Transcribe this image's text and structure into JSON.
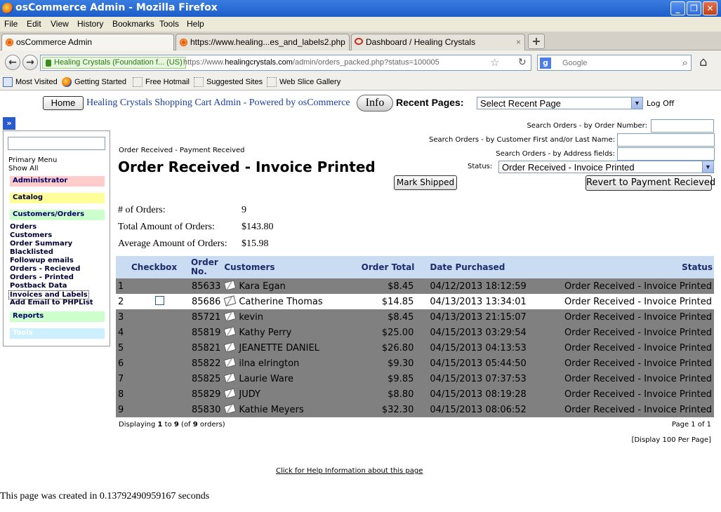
{
  "window": {
    "title": "osCommerce Admin - Mozilla Firefox",
    "min": "_",
    "max": "❐",
    "close": "✕"
  },
  "menu": [
    "File",
    "Edit",
    "View",
    "History",
    "Bookmarks",
    "Tools",
    "Help"
  ],
  "tabs": [
    {
      "label": "osCommerce Admin",
      "close": "×"
    },
    {
      "label": "https://www.healing...es_and_labels2.php",
      "close": "×"
    },
    {
      "label": "Dashboard / Healing Crystals",
      "close": "×"
    }
  ],
  "newtab": "+",
  "nav": {
    "back": "←",
    "forward": "→",
    "identity": "Healing Crystals (Foundation f...  (US)",
    "url_prefix": "https://www.",
    "url_domain": "healingcrystals.com",
    "url_path": "/admin/orders_packed.php?status=100005",
    "star": "☆",
    "reload": "↻",
    "search_engine": "g",
    "search_placeholder": "Google",
    "search_glass": "⌕",
    "home": "⌂"
  },
  "bookmarks": [
    "Most Visited",
    "Getting Started",
    "Free Hotmail",
    "Suggested Sites",
    "Web Slice Gallery"
  ],
  "header": {
    "home": "Home",
    "title": "Healing Crystals Shopping Cart Admin - Powered by osCommerce",
    "info": "Info",
    "recent_label": "Recent Pages:",
    "recent_select": "Select Recent Page",
    "logoff": "Log Off"
  },
  "sidebar": {
    "toggle": "»",
    "primary_menu": "Primary Menu",
    "show_all": "Show All",
    "sections": {
      "administrator": "Administrator",
      "catalog": "Catalog",
      "customers_orders": "Customers/Orders",
      "reports": "Reports",
      "tools": "Tools"
    },
    "links": [
      "Orders",
      "Customers",
      "Order Summary",
      "Blacklisted",
      "Followup emails",
      "Orders - Recieved",
      "Orders - Printed",
      "Postback Data",
      "Invoices and Labels",
      "Add Email to PHPList"
    ],
    "colors": {
      "administrator": "#ffcccc",
      "catalog": "#ffff99",
      "customers_orders": "#ccffcc",
      "reports": "#ccffcc",
      "tools": "#ccf0ff"
    }
  },
  "search": {
    "by_number": "Search Orders - by Order Number:",
    "by_name": "Search Orders - by Customer First and/or Last Name:",
    "by_address": "Search Orders - by Address fields:"
  },
  "main": {
    "breadcrumb": "Order Received - Payment Received",
    "heading": "Order Received - Invoice Printed",
    "status_label": "Status:",
    "status_value": "Order Received - Invoice Printed",
    "mark_shipped": "Mark Shipped",
    "revert": "Revert to Payment Recieved"
  },
  "summary": {
    "count_label": "# of Orders:",
    "count_value": "9",
    "total_label": "Total Amount of Orders:",
    "total_value": "$143.80",
    "avg_label": "Average Amount of Orders:",
    "avg_value": "$15.98"
  },
  "table": {
    "headers": {
      "checkbox": "Checkbox",
      "order_no": "Order No.",
      "customers": "Customers",
      "order_total": "Order Total",
      "date": "Date Purchased",
      "status": "Status"
    },
    "rows": [
      {
        "n": "1",
        "checkbox": false,
        "order": "85633",
        "customer": "Kara Egan",
        "total": "$8.45",
        "date": "04/12/2013 18:12:59",
        "status": "Order Received - Invoice Printed"
      },
      {
        "n": "2",
        "checkbox": true,
        "order": "85686",
        "customer": "Catherine Thomas",
        "total": "$14.85",
        "date": "04/13/2013 13:34:01",
        "status": "Order Received - Invoice Printed"
      },
      {
        "n": "3",
        "checkbox": false,
        "order": "85721",
        "customer": "kevin",
        "total": "$8.45",
        "date": "04/13/2013 21:15:07",
        "status": "Order Received - Invoice Printed"
      },
      {
        "n": "4",
        "checkbox": false,
        "order": "85819",
        "customer": "Kathy Perry",
        "total": "$25.00",
        "date": "04/15/2013 03:29:54",
        "status": "Order Received - Invoice Printed"
      },
      {
        "n": "5",
        "checkbox": false,
        "order": "85821",
        "customer": "JEANETTE DANIEL",
        "total": "$26.80",
        "date": "04/15/2013 04:13:53",
        "status": "Order Received - Invoice Printed"
      },
      {
        "n": "6",
        "checkbox": false,
        "order": "85822",
        "customer": "ilna elrington",
        "total": "$9.30",
        "date": "04/15/2013 05:44:50",
        "status": "Order Received - Invoice Printed"
      },
      {
        "n": "7",
        "checkbox": false,
        "order": "85825",
        "customer": "Laurie Ware",
        "total": "$9.85",
        "date": "04/15/2013 07:37:53",
        "status": "Order Received - Invoice Printed"
      },
      {
        "n": "8",
        "checkbox": false,
        "order": "85829",
        "customer": "JUDY",
        "total": "$8.80",
        "date": "04/15/2013 08:19:28",
        "status": "Order Received - Invoice Printed"
      },
      {
        "n": "9",
        "checkbox": false,
        "order": "85830",
        "customer": "Kathie Meyers",
        "total": "$32.30",
        "date": "04/15/2013 08:06:52",
        "status": "Order Received - Invoice Printed"
      }
    ]
  },
  "footer": {
    "displaying_pre": "Displaying ",
    "from": "1",
    "to_word": " to ",
    "to": "9",
    "of_pre": " (of ",
    "of": "9",
    "of_post": " orders)",
    "page": "Page 1 of 1",
    "per_page": "[Display 100 Per Page]",
    "help": "Click for Help Information about this page",
    "created": "This page was created in 0.13792490959167 seconds"
  }
}
